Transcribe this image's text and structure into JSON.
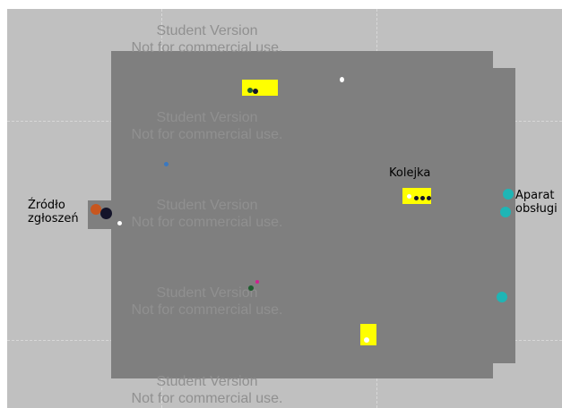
{
  "labels": {
    "source": "Źródło\nzgłoszeń",
    "queue": "Kolejka",
    "server": "Aparat\nobsługi"
  },
  "watermark": {
    "line1": "Student Version",
    "line2": "Not for commercial use."
  },
  "colors": {
    "background": "#c0c0c0",
    "board": "#7f7f7f",
    "queue_highlight": "#ffff00",
    "server_dot": "#1fb5b5",
    "source_dot": "#c8561e",
    "entity_dark": "#14142a",
    "entity_white": "#ffffff",
    "entity_blue": "#3a78c0",
    "entity_magenta": "#d02090",
    "entity_green": "#1e5e2e"
  }
}
